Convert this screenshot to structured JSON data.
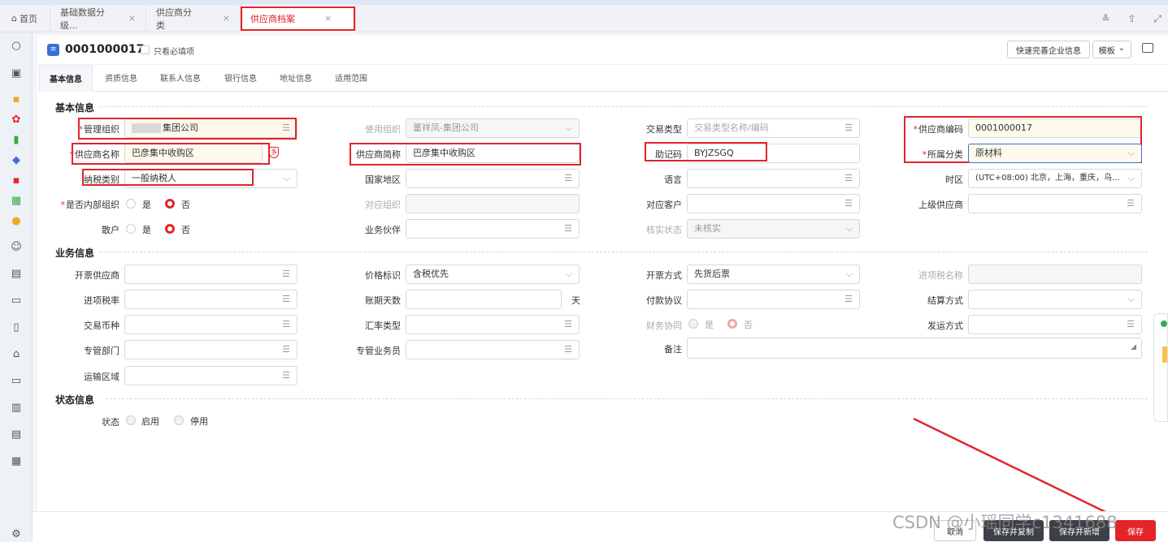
{
  "tabs": [
    {
      "label": "首页",
      "closable": false
    },
    {
      "label": "基础数据分级...",
      "closable": true
    },
    {
      "label": "供应商分类",
      "closable": true
    },
    {
      "label": "供应商档案",
      "closable": true
    }
  ],
  "tab_close": "×",
  "tabbar_icons": {
    "collapse": "≚",
    "upload": "⇧",
    "expand": "⤢"
  },
  "sidebar_icons": [
    "search-icon",
    "inbox-icon",
    "apps-icon",
    "flower-icon",
    "box-icon",
    "layers-icon",
    "tag-icon",
    "grid-icon",
    "orange-icon",
    "users-icon",
    "store-icon",
    "cart-icon",
    "clipboard-icon",
    "home-icon",
    "folder-icon",
    "shop-icon",
    "card-icon",
    "book-icon",
    "settings-icon"
  ],
  "header": {
    "code": "0001000017",
    "required_only": "只看必填项",
    "quick_fill": "快速完善企业信息",
    "template": "模板",
    "template_arrow": "⌄"
  },
  "subtabs": [
    "基本信息",
    "资质信息",
    "联系人信息",
    "银行信息",
    "地址信息",
    "适用范围"
  ],
  "sections": {
    "basic": "基本信息",
    "business": "业务信息",
    "status": "状态信息"
  },
  "basic": {
    "mgmt_org_label": "管理组织",
    "mgmt_org_value": "集团公司",
    "use_org_label": "使用组织",
    "use_org_value": "董祥凤-集团公司",
    "trade_type_label": "交易类型",
    "trade_type_placeholder": "交易类型名称/编码",
    "supplier_code_label": "供应商编码",
    "supplier_code_value": "0001000017",
    "supplier_name_label": "供应商名称",
    "supplier_name_value": "巴彦集中收购区",
    "supplier_short_label": "供应商简称",
    "supplier_short_value": "巴彦集中收购区",
    "mnemonic_label": "助记码",
    "mnemonic_value": "BYJZSGQ",
    "category_label": "所属分类",
    "category_value": "原材料",
    "tax_type_label": "纳税类别",
    "tax_type_value": "一般纳税人",
    "country_label": "国家地区",
    "language_label": "语言",
    "timezone_label": "时区",
    "timezone_value": "(UTC+08:00) 北京，上海，重庆，乌...",
    "internal_label": "是否内部组织",
    "yes": "是",
    "no": "否",
    "counter_org_label": "对应组织",
    "counter_customer_label": "对应客户",
    "parent_supplier_label": "上级供应商",
    "casual_label": "散户",
    "partner_label": "业务伙伴",
    "verify_status_label": "核实状态",
    "verify_status_value": "未核实"
  },
  "business": {
    "invoice_supplier_label": "开票供应商",
    "price_mark_label": "价格标识",
    "price_mark_value": "含税优先",
    "invoice_method_label": "开票方式",
    "invoice_method_value": "先货后票",
    "input_tax_name_label": "进项税名称",
    "input_tax_rate_label": "进项税率",
    "credit_days_label": "账期天数",
    "credit_days_unit": "天",
    "payment_terms_label": "付款协议",
    "settle_label": "结算方式",
    "currency_label": "交易币种",
    "rate_type_label": "汇率类型",
    "finance_sync_label": "财务协同",
    "yes": "是",
    "no": "否",
    "ship_method_label": "发运方式",
    "dept_label": "专管部门",
    "staff_label": "专管业务员",
    "remark_label": "备注",
    "region_label": "运输区域"
  },
  "status": {
    "label": "状态",
    "enabled": "启用",
    "disabled": "停用"
  },
  "footer": {
    "cancel": "取消",
    "save_copy": "保存并复制",
    "save_new": "保存并新增",
    "save": "保存"
  },
  "watermark": "CSDN @小瑶同学c1341688",
  "colors": {
    "accent": "#e3242b",
    "brand_blue": "#3b6fd8",
    "dark_button": "#3d4046",
    "required_bg": "#fdf9ec"
  }
}
